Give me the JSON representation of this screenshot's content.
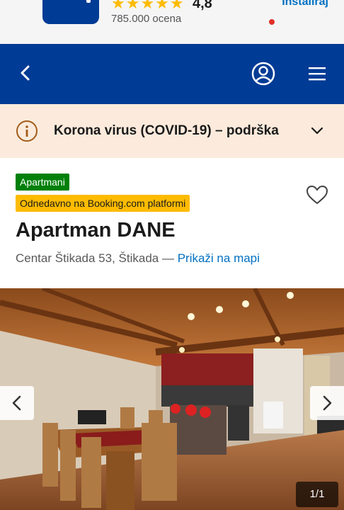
{
  "app_banner": {
    "stars": "★★★★★",
    "rating": "4,8",
    "reviews": "785.000 ocena",
    "install_label": "Instaliraj"
  },
  "header": {
    "back_icon": "chevron-left-icon",
    "profile_icon": "user-circle-icon",
    "menu_icon": "hamburger-menu-icon",
    "background": "#003b95",
    "notification_color": "#e0312a"
  },
  "notice": {
    "text": "Korona virus (COVID-19) – podrška",
    "background": "#fcebdc"
  },
  "property": {
    "type_badge": "Apartmani",
    "new_badge": "Odnedavno na Booking.com platformi",
    "title": "Apartman DANE",
    "address": "Centar Štikada 53, Štikada —",
    "map_link": "Prikaži na mapi"
  },
  "gallery": {
    "counter": "1/1"
  }
}
